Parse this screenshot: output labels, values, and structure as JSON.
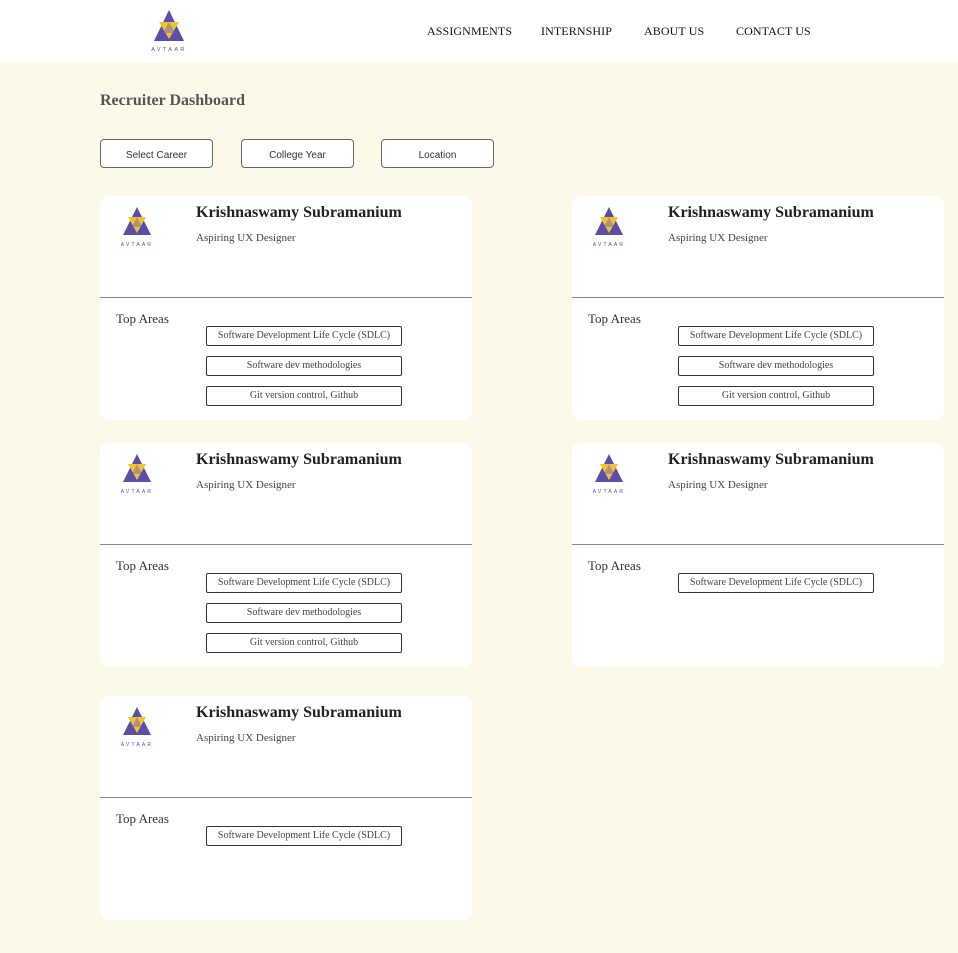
{
  "header": {
    "logo_text": "AVTAAR",
    "nav": [
      "ASSIGNMENTS",
      "INTERNSHIP",
      "ABOUT US",
      "CONTACT US"
    ]
  },
  "page": {
    "title": "Recruiter Dashboard"
  },
  "filters": [
    "Select Career",
    "College Year",
    "Location"
  ],
  "section_label": "Top Areas",
  "cards": [
    {
      "name": "Krishnaswamy Subramanium",
      "role": "Aspiring UX Designer",
      "areas": [
        "Software Development Life Cycle (SDLC)",
        "Software dev methodologies",
        "Git version control, Github"
      ]
    },
    {
      "name": "Krishnaswamy Subramanium",
      "role": "Aspiring UX Designer",
      "areas": [
        "Software Development Life Cycle (SDLC)",
        "Software dev methodologies",
        "Git version control, Github"
      ]
    },
    {
      "name": "Krishnaswamy Subramanium",
      "role": "Aspiring UX Designer",
      "areas": [
        "Software Development Life Cycle (SDLC)",
        "Software dev methodologies",
        "Git version control, Github"
      ]
    },
    {
      "name": "Krishnaswamy Subramanium",
      "role": "Aspiring UX Designer",
      "areas": [
        "Software Development Life Cycle (SDLC)"
      ]
    },
    {
      "name": "Krishnaswamy Subramanium",
      "role": "Aspiring UX Designer",
      "areas": [
        "Software Development Life Cycle (SDLC)"
      ]
    }
  ],
  "colors": {
    "background": "#fdf9e8",
    "logo_purple": "#5b4da8",
    "logo_yellow": "#f2c230"
  }
}
